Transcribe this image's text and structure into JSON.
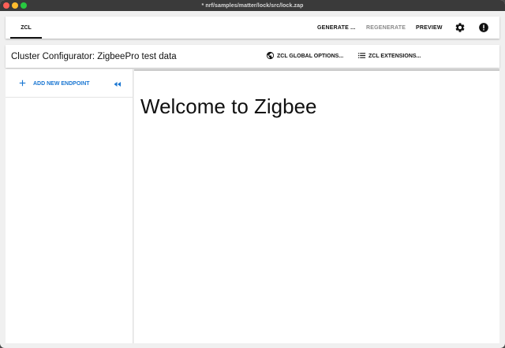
{
  "window": {
    "title": "* nrf/samples/matter/lock/src/lock.zap"
  },
  "appbar": {
    "tab_label": "ZCL",
    "generate_label": "GENERATE ...",
    "regenerate_label": "REGENERATE",
    "preview_label": "PREVIEW"
  },
  "subbar": {
    "title": "Cluster Configurator: ZigbeePro test data",
    "global_options_label": "ZCL GLOBAL OPTIONS...",
    "extensions_label": "ZCL EXTENSIONS..."
  },
  "sidebar": {
    "add_endpoint_label": "ADD NEW ENDPOINT"
  },
  "main": {
    "welcome_text": "Welcome to Zigbee"
  },
  "icons": {
    "settings": "gear-icon",
    "alert": "alert-icon",
    "globe": "globe-icon",
    "list": "list-icon",
    "add": "plus-icon",
    "collapse": "double-chevron-left-icon"
  },
  "colors": {
    "accent": "#1976d2",
    "titlebar": "#3a3a3a",
    "background": "#f0f0f0"
  }
}
